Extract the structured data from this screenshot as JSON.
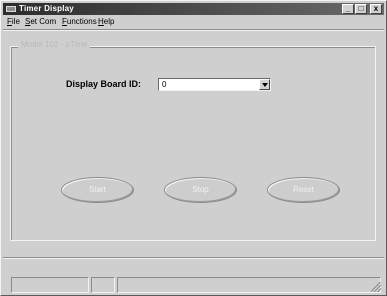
{
  "window": {
    "title": "Timer Display",
    "minimize_symbol": "_",
    "maximize_symbol": "□",
    "close_symbol": "x"
  },
  "menu": {
    "file": {
      "accel": "F",
      "rest": "ile"
    },
    "setcom": {
      "accel": "S",
      "rest": "et Com"
    },
    "functions": {
      "accel": "F",
      "rest": "unctions"
    },
    "help": {
      "accel": "H",
      "rest": "elp"
    }
  },
  "group": {
    "label": "Model 102 - pTime"
  },
  "display_board": {
    "label": "Display Board ID:",
    "value": "0"
  },
  "buttons": {
    "start": "Start",
    "stop": "Stop",
    "reset": "Reset"
  },
  "icons": {
    "app": "app-icon",
    "dropdown": "chevron-down-icon",
    "grip": "resize-grip-icon"
  }
}
